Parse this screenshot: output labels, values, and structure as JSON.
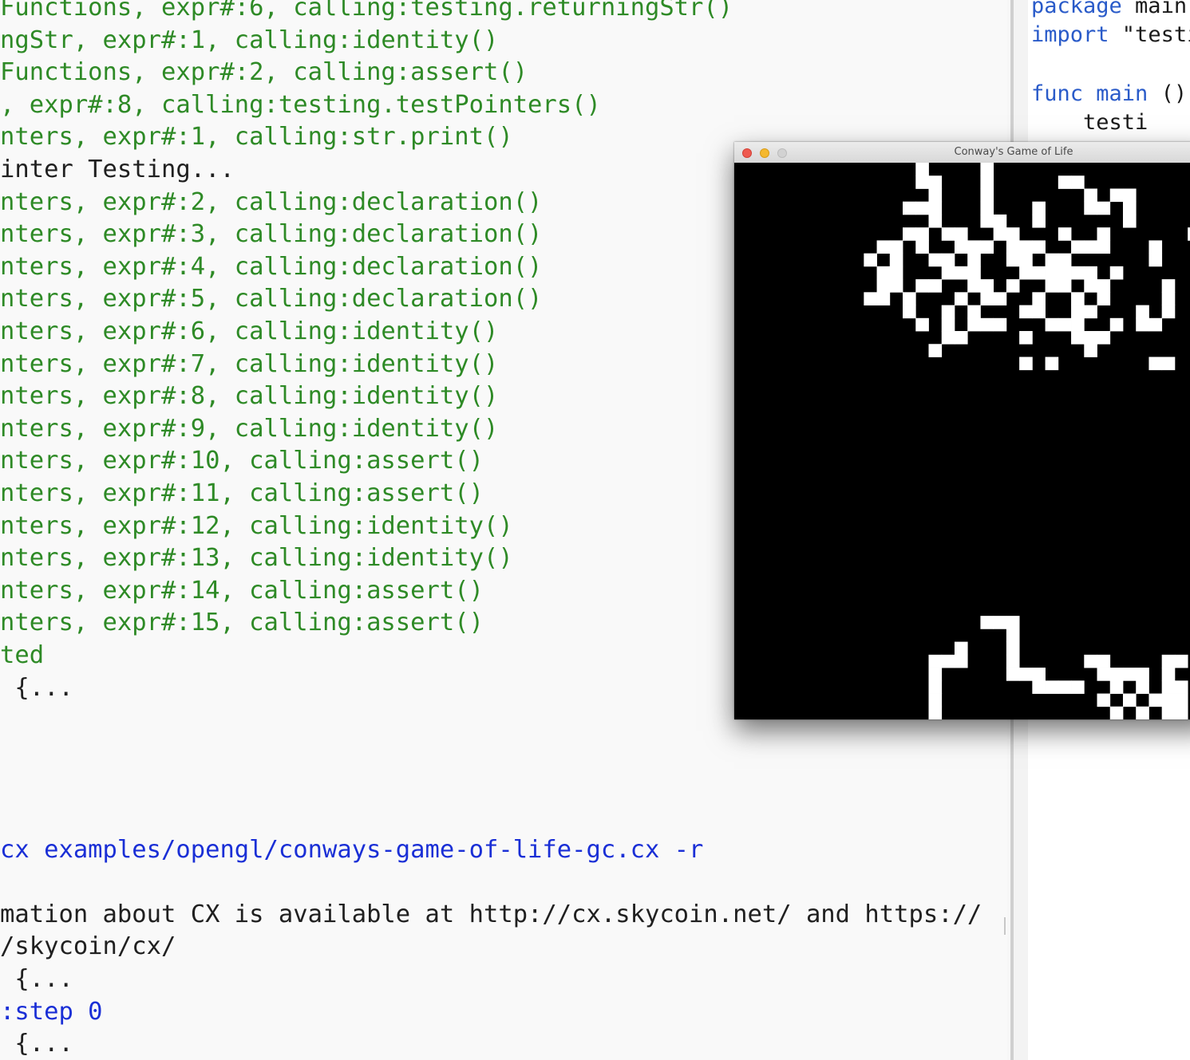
{
  "terminal": {
    "lines": [
      {
        "text": "Functions, expr#:6, calling:testing.returningStr()",
        "color": "green"
      },
      {
        "text": "ngStr, expr#:1, calling:identity()",
        "color": "green"
      },
      {
        "text": "Functions, expr#:2, calling:assert()",
        "color": "green"
      },
      {
        "text": ", expr#:8, calling:testing.testPointers()",
        "color": "green"
      },
      {
        "text": "nters, expr#:1, calling:str.print()",
        "color": "green"
      },
      {
        "text": "inter Testing...",
        "color": "black"
      },
      {
        "text": "nters, expr#:2, calling:declaration()",
        "color": "green"
      },
      {
        "text": "nters, expr#:3, calling:declaration()",
        "color": "green"
      },
      {
        "text": "nters, expr#:4, calling:declaration()",
        "color": "green"
      },
      {
        "text": "nters, expr#:5, calling:declaration()",
        "color": "green"
      },
      {
        "text": "nters, expr#:6, calling:identity()",
        "color": "green"
      },
      {
        "text": "nters, expr#:7, calling:identity()",
        "color": "green"
      },
      {
        "text": "nters, expr#:8, calling:identity()",
        "color": "green"
      },
      {
        "text": "nters, expr#:9, calling:identity()",
        "color": "green"
      },
      {
        "text": "nters, expr#:10, calling:assert()",
        "color": "green"
      },
      {
        "text": "nters, expr#:11, calling:assert()",
        "color": "green"
      },
      {
        "text": "nters, expr#:12, calling:identity()",
        "color": "green"
      },
      {
        "text": "nters, expr#:13, calling:identity()",
        "color": "green"
      },
      {
        "text": "nters, expr#:14, calling:assert()",
        "color": "green"
      },
      {
        "text": "nters, expr#:15, calling:assert()",
        "color": "green"
      },
      {
        "text": "ted",
        "color": "green"
      },
      {
        "text": " {...",
        "color": "black"
      },
      {
        "text": "",
        "color": "black"
      },
      {
        "text": "",
        "color": "black"
      },
      {
        "text": "",
        "color": "black"
      },
      {
        "text": "",
        "color": "black"
      },
      {
        "text": "cx examples/opengl/conways-game-of-life-gc.cx -r",
        "color": "blue"
      },
      {
        "text": "",
        "color": "black"
      },
      {
        "text": "mation about CX is available at http://cx.skycoin.net/ and https://",
        "color": "black"
      },
      {
        "text": "/skycoin/cx/",
        "color": "black"
      },
      {
        "text": " {...",
        "color": "black"
      },
      {
        "text": ":step 0",
        "color": "blue"
      },
      {
        "text": " {...",
        "color": "black"
      }
    ]
  },
  "editor": {
    "line1": {
      "kw": "package",
      "rest": " main"
    },
    "line2": {
      "kw": "import",
      "rest": " \"testi"
    },
    "line3": {
      "kw": "func",
      "name": " main",
      "rest": " ()"
    },
    "line4": {
      "rest": "    testi"
    }
  },
  "game_window": {
    "title": "Conway's Game of Life",
    "colors": {
      "alive": "#ffffff",
      "dead": "#000000"
    },
    "grid": {
      "rows": [
        "--------------X----X----------------",
        "--------------XX---X-----XX---------",
        "---------------X---X-------X-XX-----",
        "-------------XXX---X---X---XX-X-----",
        "---------------X---XX--X------X-----",
        "-------------XX-XX--XX---X--X------X",
        "-----------XX-X--XXX-XXX--XXX---X---",
        "----------X-X--XX-X--XX-XX------X---",
        "-----------XX---XXX---XXXXXX-X------",
        "-----------XX-XX--XX-X--XX-XX----X--",
        "----------XX-X---X-XX--X--X-X----X--",
        "-------------X--X-X---XX--XX---X-X--",
        "--------------X-X-XXX---XXX--X-XX---",
        "----------------XX----X---XXX-------",
        "---------------X-----------X--------",
        "----------------------X-X-------XX--",
        "------------------------------------",
        "------------------------------------",
        "------------------------------------",
        "------------------------------------",
        "------------------------------------",
        "------------------------------------",
        "------------------------------------",
        "------------------------------------",
        "------------------------------------",
        "------------------------------------",
        "------------------------------------",
        "------------------------------------",
        "------------------------------------",
        "------------------------------------",
        "------------------------------------",
        "------------------------------------",
        "------------------------------------",
        "------------------------------------",
        "------------------------------------",
        "-------------------XXX--------------",
        "---------------------X--------------",
        "-----------------X---X--------------",
        "---------------XXX---X-----XX----XX-",
        "---------------X-----XXX----XXXX-X--",
        "---------------X-------XXXX--X-X-XX-",
        "---------------X------------X-X-XXX-",
        "---------------X-------------X-X-XX-"
      ]
    }
  }
}
